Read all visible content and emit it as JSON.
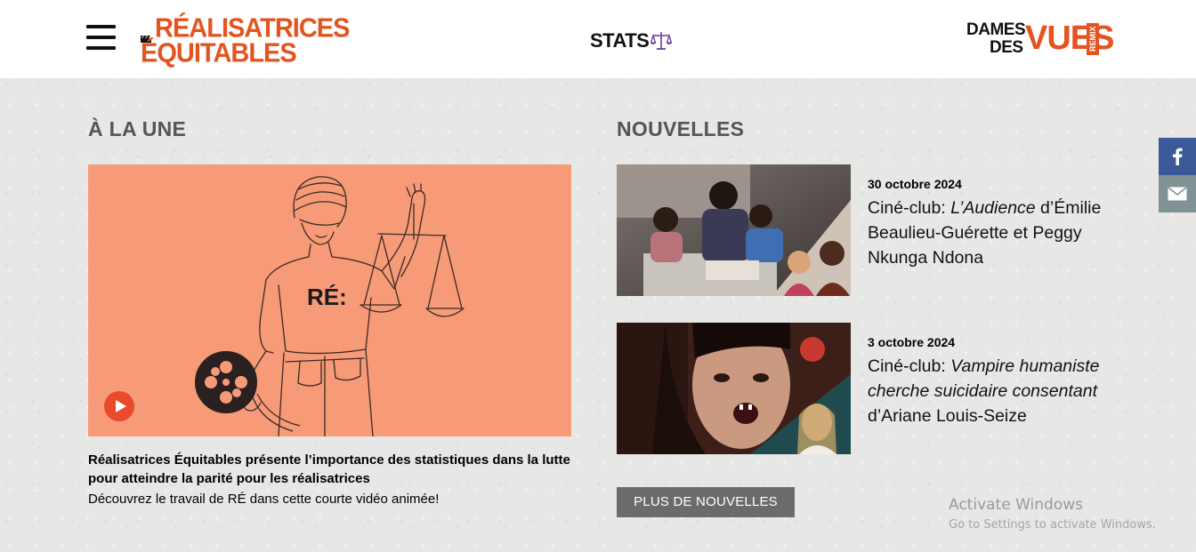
{
  "header": {
    "logo_line1": "RÉALISATRICES",
    "logo_line2": "ÉQUITABLES",
    "stats_label": "STATS",
    "partner_word1": "DAMES",
    "partner_word2": "DES",
    "partner_word3": "VUES",
    "partner_tag": "REMIX"
  },
  "featured": {
    "section_title": "À LA UNE",
    "shirt_text": "RÉ:",
    "caption_title": "Réalisatrices Équitables présente l’importance des statistiques dans la lutte pour atteindre la parité pour les réalisatrices",
    "caption_sub": "Découvrez le travail de RÉ dans cette courte vidéo animée!"
  },
  "news": {
    "section_title": "NOUVELLES",
    "items": [
      {
        "date": "30 octobre 2024",
        "prefix": "Ciné-club: ",
        "film_title": "L’Audience",
        "suffix": " d’Émilie Beaulieu-Guérette et Peggy Nkunga Ndona"
      },
      {
        "date": "3 octobre 2024",
        "prefix": "Ciné-club: ",
        "film_title": "Vampire humaniste cherche suicidaire consentant",
        "suffix": " d’Ariane Louis-Seize"
      }
    ],
    "more_button": "PLUS DE NOUVELLES"
  },
  "share": {
    "facebook_icon": "facebook-icon",
    "mail_icon": "mail-icon"
  },
  "watermark": {
    "line1": "Activate Windows",
    "line2": "Go to Settings to activate Windows."
  },
  "colors": {
    "brand_orange": "#e25520",
    "featured_bg": "#f79a77",
    "button_grey": "#6b6b6b",
    "facebook_blue": "#3b5998"
  }
}
